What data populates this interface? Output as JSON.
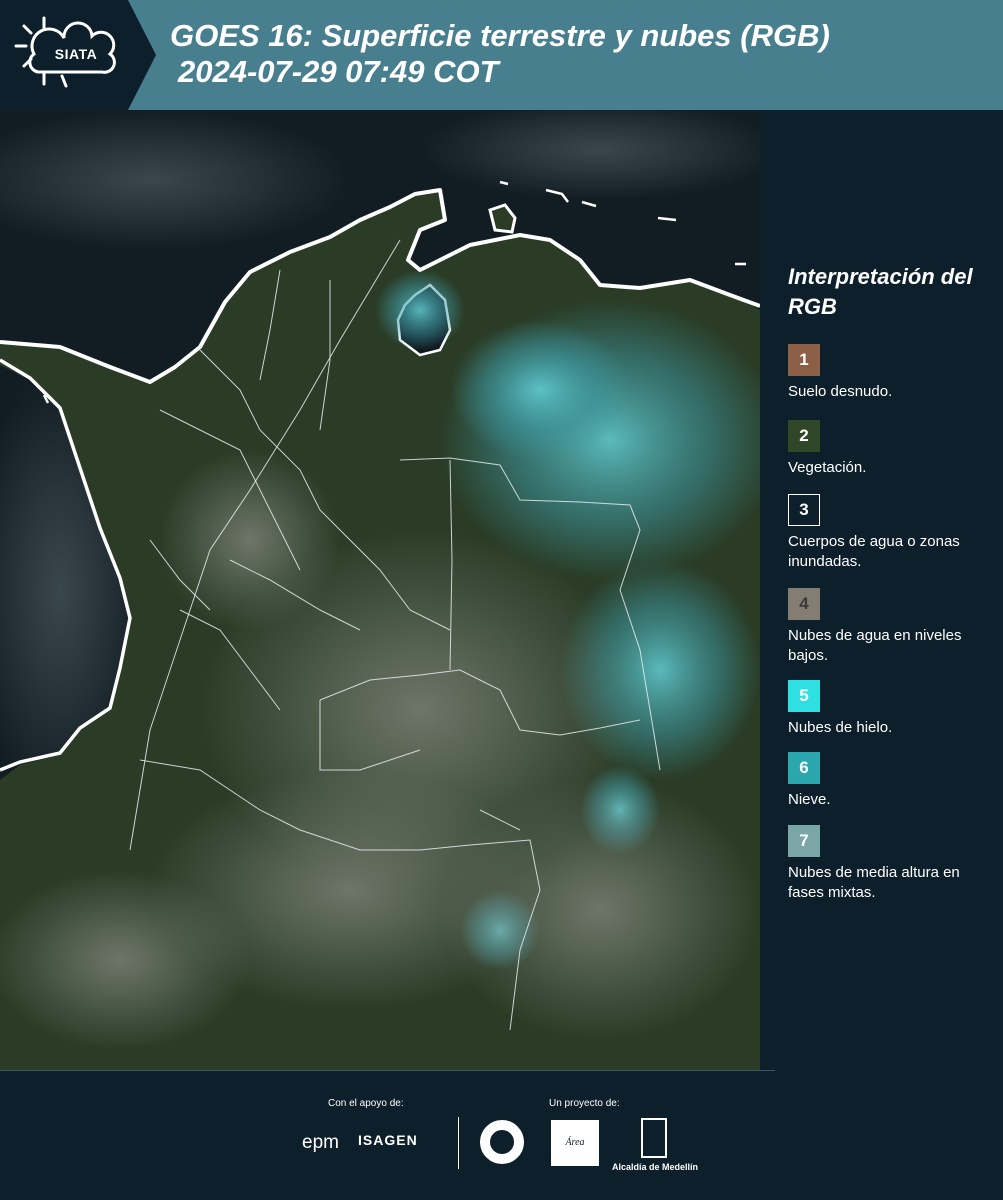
{
  "header": {
    "logo_text": "SIATA",
    "title": "GOES 16: Superficie terrestre y nubes (RGB)",
    "subtitle": "2024-07-29 07:49 COT"
  },
  "legend": {
    "title": "Interpretación del RGB",
    "items": [
      {
        "number": "1",
        "label": "Suelo desnudo.",
        "color": "#8b5e46"
      },
      {
        "number": "2",
        "label": "Vegetación.",
        "color": "#2f4726"
      },
      {
        "number": "3",
        "label": "Cuerpos de agua o zonas inundadas.",
        "color": "#0d1f2b"
      },
      {
        "number": "4",
        "label": "Nubes de agua en niveles bajos.",
        "color": "#847e72"
      },
      {
        "number": "5",
        "label": "Nubes de hielo.",
        "color": "#2ee0e2"
      },
      {
        "number": "6",
        "label": "Nieve.",
        "color": "#2aa7ac"
      },
      {
        "number": "7",
        "label": "Nubes de media altura en fases mixtas.",
        "color": "#7aa6a8"
      }
    ]
  },
  "footer": {
    "support_label": "Con el apoyo de:",
    "project_label": "Un proyecto de:",
    "epm": "epm",
    "isagen": "ISAGEN",
    "area_logo": "Área",
    "alcaldia": "Alcaldía de Medellín"
  },
  "map": {
    "land_color": "#2c3d27",
    "ocean_color": "#111c22",
    "cloud_color": "#4fb5c0",
    "coastline_color": "#ffffff"
  }
}
